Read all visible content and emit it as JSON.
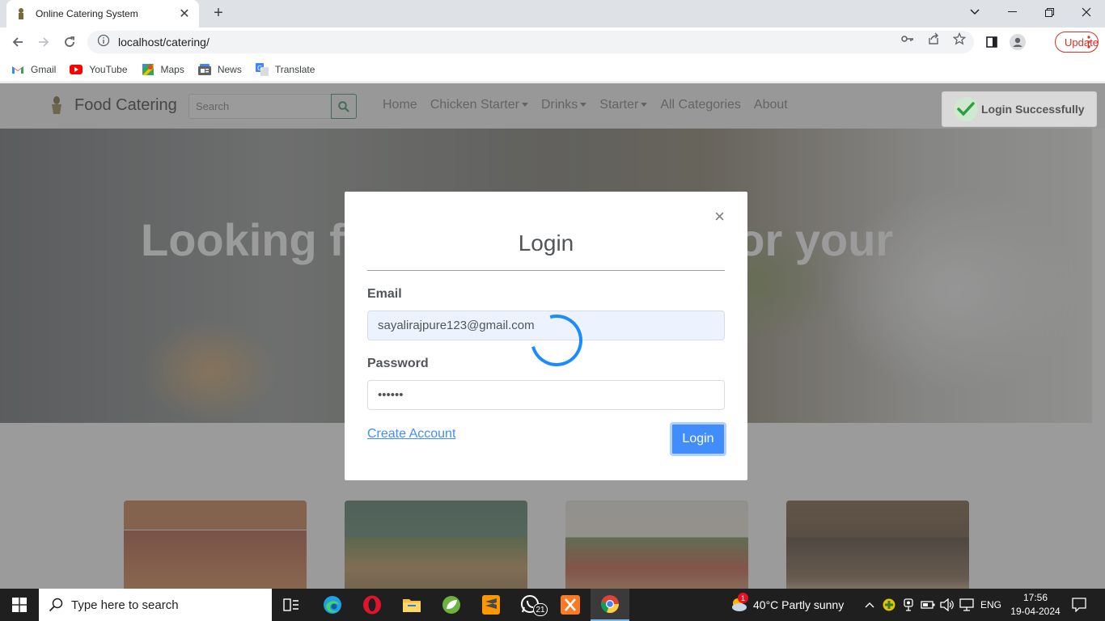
{
  "browser": {
    "tab_title": "Online Catering System",
    "url": "localhost/catering/",
    "update_label": "Update",
    "bookmarks": [
      "Gmail",
      "YouTube",
      "Maps",
      "News",
      "Translate"
    ]
  },
  "site": {
    "brand": "Food Catering",
    "search_placeholder": "Search",
    "menu": {
      "home": "Home",
      "chicken_starter": "Chicken Starter",
      "drinks": "Drinks",
      "starter": "Starter",
      "all_categories": "All Categories",
      "about": "About"
    },
    "hero_left": "Looking f",
    "hero_right": "s for your"
  },
  "modal": {
    "title": "Login",
    "close": "×",
    "email_label": "Email",
    "email_value": "sayalirajpure123@gmail.com",
    "password_label": "Password",
    "password_value": "••••••",
    "create_account": "Create Account",
    "login_button": "Login"
  },
  "toast": {
    "message": "Login Successfully"
  },
  "taskbar": {
    "search_placeholder": "Type here to search",
    "whatsapp_badge": "21",
    "weather_badge": "1",
    "weather": "40°C  Partly sunny",
    "language": "ENG",
    "time": "17:56",
    "date": "19-04-2024"
  },
  "colors": {
    "primary": "#0d6efd",
    "success": "#198754",
    "spinner": "#1a8cff",
    "update": "#d93025"
  }
}
